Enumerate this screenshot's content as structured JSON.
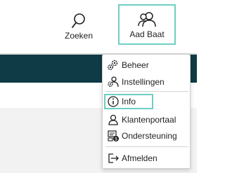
{
  "header": {
    "search_label": "Zoeken",
    "search_icon": "search-icon",
    "user_label": "Aad Baat",
    "user_icon": "users-icon"
  },
  "colors": {
    "accent": "#6dcfc3",
    "navbar": "#0e3b45",
    "content_bg": "#f2f2f2"
  },
  "user_menu": {
    "items": [
      {
        "label": "Beheer",
        "icon": "gears-icon"
      },
      {
        "label": "Instellingen",
        "icon": "user-gear-icon"
      },
      {
        "label": "Info",
        "icon": "info-icon",
        "highlighted": true
      },
      {
        "label": "Klantenportaal",
        "icon": "user-icon"
      },
      {
        "label": "Ondersteuning",
        "icon": "support-icon"
      },
      {
        "label": "Afmelden",
        "icon": "logout-icon"
      }
    ]
  }
}
